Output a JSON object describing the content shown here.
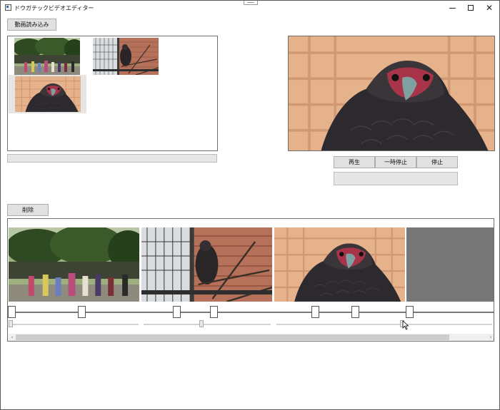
{
  "window": {
    "title": "ドウガテックビデオエディター",
    "minimize_icon": "minimize-icon",
    "maximize_icon": "maximize-icon",
    "close_icon": "close-icon",
    "close_glyph": "✕"
  },
  "toolbar": {
    "load_label": "動画読み込み",
    "delete_label": "削除"
  },
  "player": {
    "play_label": "再生",
    "pause_label": "一時停止",
    "stop_label": "停止"
  },
  "media_list": {
    "items": [
      {
        "icon": "park-crowd-thumbnail"
      },
      {
        "icon": "bird-cage-thumbnail"
      },
      {
        "icon": "eagle-closeup-thumbnail",
        "selected": true
      }
    ]
  },
  "timeline": {
    "clips": [
      {
        "icon": "park-crowd-frame"
      },
      {
        "icon": "bird-cage-frame"
      },
      {
        "icon": "eagle-closeup-frame"
      },
      {
        "icon": "empty-frame"
      }
    ],
    "scroll_left_glyph": "‹",
    "scroll_right_glyph": "›"
  },
  "colors": {
    "button_face": "#e1e1e1",
    "border": "#6e6e6e",
    "empty_frame": "#777777"
  }
}
